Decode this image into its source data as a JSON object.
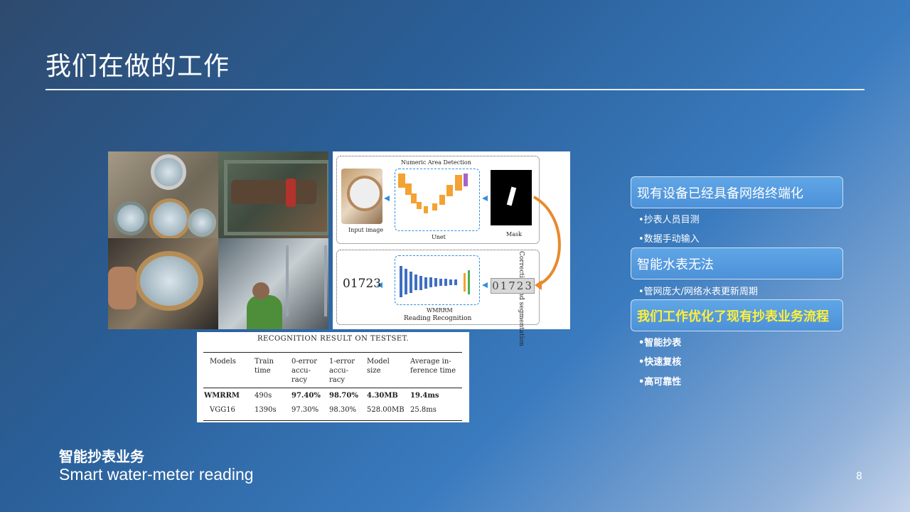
{
  "title": "我们在做的工作",
  "diagram": {
    "top_label": "Numeric Area Detection",
    "input_label": "Input image",
    "unet_label": "Unet",
    "mask_label": "Mask",
    "side_label": "Correction and segmentation",
    "result_label": "01723",
    "digits": "01723",
    "model_label": "WMRRM",
    "bottom_label": "Reading Recognition"
  },
  "table": {
    "caption": "RECOGNITION RESULT ON TESTSET.",
    "headers": [
      "Models",
      "Train\ntime",
      "0-error\naccu-\nracy",
      "1-error\naccu-\nracy",
      "Model\nsize",
      "Average in-\nference time"
    ],
    "rows": [
      [
        "WMRRM",
        "490s",
        "97.40%",
        "98.70%",
        "4.30MB",
        "19.4ms"
      ],
      [
        "VGG16",
        "1390s",
        "97.30%",
        "98.30%",
        "528.00MB",
        "25.8ms"
      ]
    ]
  },
  "panel": {
    "box1": "现有设备已经具备网络终端化",
    "box1_items": [
      "•抄表人员目测",
      "•数据手动输入"
    ],
    "box2": "智能水表无法",
    "box2_items": [
      "•管网庞大/网络水表更新周期"
    ],
    "box3": "我们工作优化了现有抄表业务流程",
    "box3_items": [
      "•智能抄表",
      "•快速复核",
      "•高可靠性"
    ]
  },
  "footer": {
    "subtitle": "智能抄表业务",
    "subtitle_en": "Smart water-meter reading",
    "page_number": "8"
  },
  "colors": {
    "highlight": "#ffef3a",
    "box_fill": "#4d91d8",
    "arrow_orange": "#e88a2c",
    "arrow_blue": "#2f8ee0"
  }
}
